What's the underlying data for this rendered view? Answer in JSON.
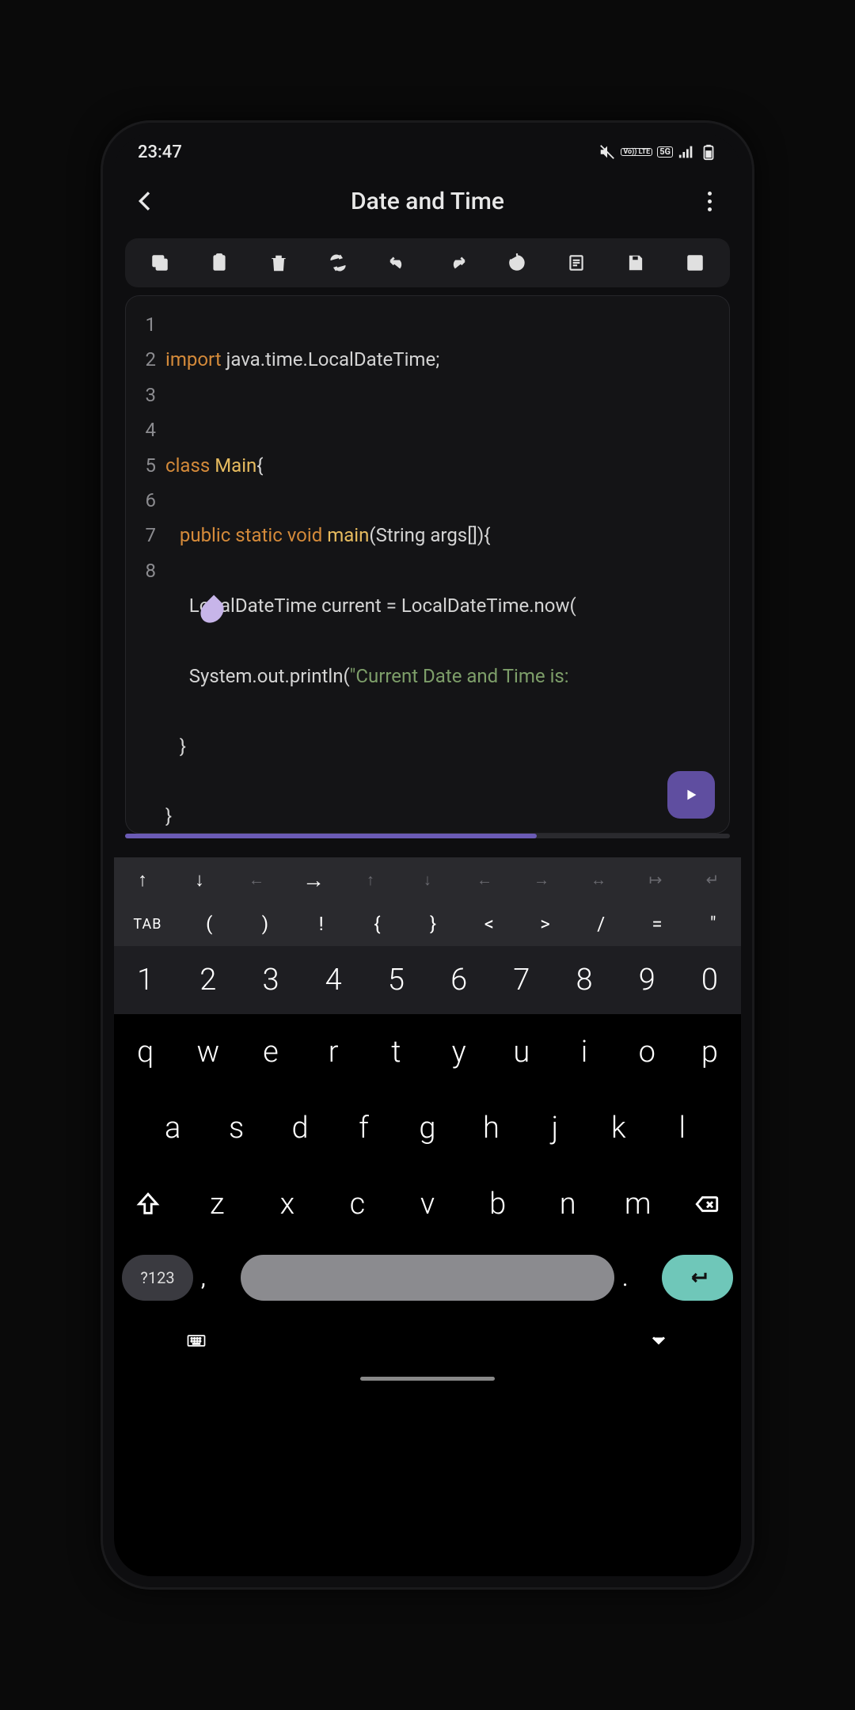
{
  "status": {
    "time": "23:47",
    "net": "5G",
    "volte": "Vo))\nLTE"
  },
  "appbar": {
    "title": "Date and Time"
  },
  "code": {
    "lines": [
      {
        "n": "1",
        "import_kw": "import",
        "import_rest": " java.time.LocalDateTime;"
      },
      {
        "n": "2",
        "blank": ""
      },
      {
        "n": "3",
        "class_kw": "class",
        "class_name": " Main",
        "class_rest": "{"
      },
      {
        "n": "4",
        "mods": "   public static void",
        "fn": " main",
        "sig": "(String args[]){"
      },
      {
        "n": "5",
        "body": "     LocalDateTime current = LocalDateTime.now("
      },
      {
        "n": "6",
        "body_a": "     System.out.println(",
        "str": "\"Current Date and Time is:"
      },
      {
        "n": "7",
        "body": "   }"
      },
      {
        "n": "8",
        "body": "}"
      }
    ]
  },
  "progress_pct": "68%",
  "acc1": [
    "↑",
    "↓",
    "←",
    "→",
    "↑",
    "↓",
    "←",
    "→",
    "↔",
    "↦",
    "↵"
  ],
  "acc2": [
    "TAB",
    "(",
    ")",
    "!",
    "{",
    "}",
    "<",
    ">",
    "/",
    "=",
    "\""
  ],
  "nums": [
    "1",
    "2",
    "3",
    "4",
    "5",
    "6",
    "7",
    "8",
    "9",
    "0"
  ],
  "rowA": [
    "q",
    "w",
    "e",
    "r",
    "t",
    "y",
    "u",
    "i",
    "o",
    "p"
  ],
  "rowB": [
    "a",
    "s",
    "d",
    "f",
    "g",
    "h",
    "j",
    "k",
    "l"
  ],
  "rowC": [
    "z",
    "x",
    "c",
    "v",
    "b",
    "n",
    "m"
  ],
  "sym": "?123",
  "comma": ",",
  "dot": "."
}
